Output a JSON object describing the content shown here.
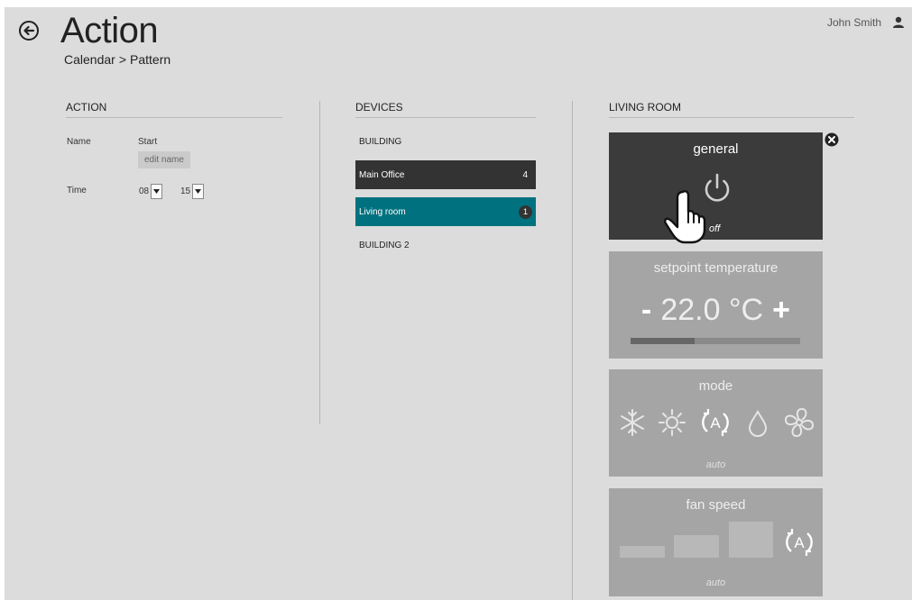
{
  "header": {
    "title": "Action",
    "breadcrumb": [
      "Calendar",
      "Pattern"
    ],
    "breadcrumb_sep": ">",
    "user_name": "John Smith"
  },
  "action": {
    "heading": "ACTION",
    "name_label": "Name",
    "name_value": "Start",
    "edit_name_label": "edit name",
    "time_label": "Time",
    "hour": "08",
    "minute": "15"
  },
  "devices": {
    "heading": "DEVICES",
    "building1": "BUILDING",
    "items": [
      {
        "name": "Main Office",
        "count": "4"
      },
      {
        "name": "Living room",
        "count": "1"
      }
    ],
    "building2": "BUILDING 2"
  },
  "room": {
    "heading": "LIVING ROOM",
    "general": {
      "title": "general",
      "state": "off"
    },
    "setpoint": {
      "title": "setpoint temperature",
      "minus": "-",
      "value": "22.0 °C",
      "plus": "+",
      "level": 0.38
    },
    "mode": {
      "title": "mode",
      "icons": [
        "snowflake-icon",
        "sun-icon",
        "auto-icon",
        "drop-icon",
        "fan-icon"
      ],
      "value": "auto"
    },
    "fan": {
      "title": "fan speed",
      "value": "auto",
      "levels": [
        "low",
        "medium",
        "high",
        "auto"
      ]
    }
  },
  "colors": {
    "background": "#dcdcdc",
    "dark_tile": "#3b3b3b",
    "selected": "#00727f",
    "disabled_tile": "#a5a5a5"
  }
}
